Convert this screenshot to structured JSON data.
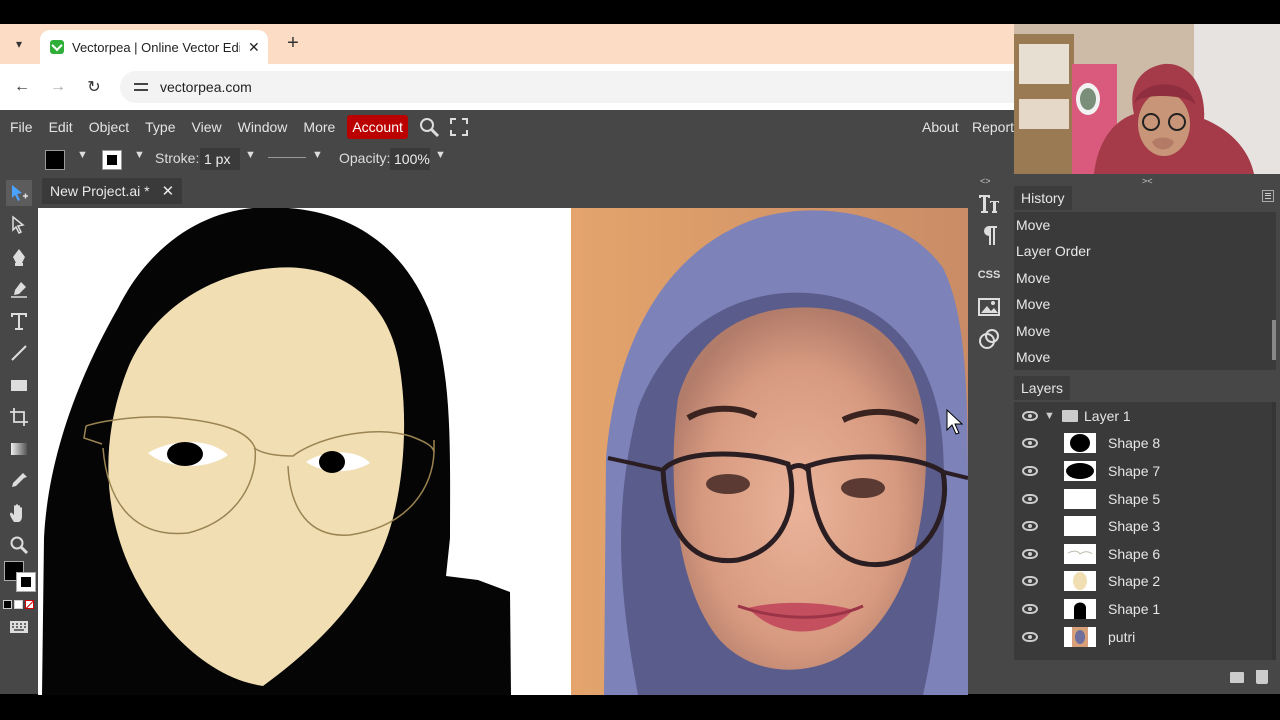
{
  "browser": {
    "tab_title": "Vectorpea | Online Vector Editor",
    "url": "vectorpea.com"
  },
  "menubar": {
    "items": [
      "File",
      "Edit",
      "Object",
      "Type",
      "View",
      "Window",
      "More"
    ],
    "account_label": "Account",
    "right_items": [
      "About",
      "Report"
    ]
  },
  "tool_options": {
    "stroke_label": "Stroke:",
    "stroke_value": "1 px",
    "opacity_label": "Opacity:",
    "opacity_value": "100%"
  },
  "document": {
    "tab_name": "New Project.ai *"
  },
  "side_icons": {
    "css_label": "CSS"
  },
  "history": {
    "title": "History",
    "items": [
      "Move",
      "Layer Order",
      "Move",
      "Move",
      "Move",
      "Move"
    ]
  },
  "layers": {
    "title": "Layers",
    "group": "Layer 1",
    "items": [
      "Shape 8",
      "Shape 7",
      "Shape 5",
      "Shape 3",
      "Shape 6",
      "Shape 2",
      "Shape 1",
      "putri"
    ]
  },
  "colors": {
    "account_bg": "#bb0000",
    "panel_bg": "#474747",
    "skin": "#f1deb3",
    "hijab": "#050505",
    "glasses": "#9b8452",
    "browser_tabbar": "#fcdcc4"
  }
}
